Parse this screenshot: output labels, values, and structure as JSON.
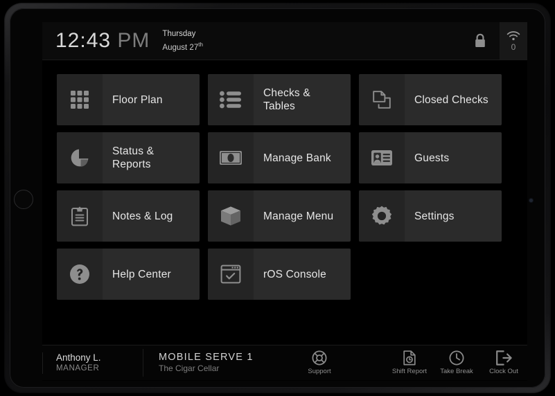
{
  "header": {
    "time": "12:43",
    "ampm": "PM",
    "day_of_week": "Thursday",
    "month_day": "August 27",
    "ordinal": "th",
    "lock_icon": "lock-icon",
    "wifi_icon": "wifi-icon",
    "wifi_count": "0"
  },
  "tiles": [
    {
      "label": "Floor Plan",
      "icon": "grid-icon"
    },
    {
      "label": "Checks & Tables",
      "icon": "list-icon"
    },
    {
      "label": "Closed Checks",
      "icon": "copy-documents-icon"
    },
    {
      "label": "Status & Reports",
      "icon": "pie-chart-icon"
    },
    {
      "label": "Manage Bank",
      "icon": "banknote-icon"
    },
    {
      "label": "Guests",
      "icon": "id-card-icon"
    },
    {
      "label": "Notes & Log",
      "icon": "clipboard-icon"
    },
    {
      "label": "Manage Menu",
      "icon": "box-icon"
    },
    {
      "label": "Settings",
      "icon": "gear-icon"
    },
    {
      "label": "Help Center",
      "icon": "question-circle-icon"
    },
    {
      "label": "rOS Console",
      "icon": "window-check-icon"
    }
  ],
  "footer": {
    "user_name": "Anthony L.",
    "user_role": "MANAGER",
    "venue_name": "MOBILE SERVE 1",
    "venue_sub": "The Cigar Cellar",
    "actions": [
      {
        "label": "Support",
        "icon": "life-ring-icon"
      },
      {
        "label": "Shift Report",
        "icon": "document-clock-icon"
      },
      {
        "label": "Take Break",
        "icon": "clock-icon"
      },
      {
        "label": "Clock Out",
        "icon": "exit-arrow-icon"
      }
    ]
  },
  "colors": {
    "screen_bg": "#000000",
    "tile_bg": "#2b2b2b",
    "tile_icon_bg": "#242424",
    "icon_fill": "#8e8e8e",
    "text_primary": "#e6e6e6",
    "text_muted": "#8a8a8a"
  }
}
